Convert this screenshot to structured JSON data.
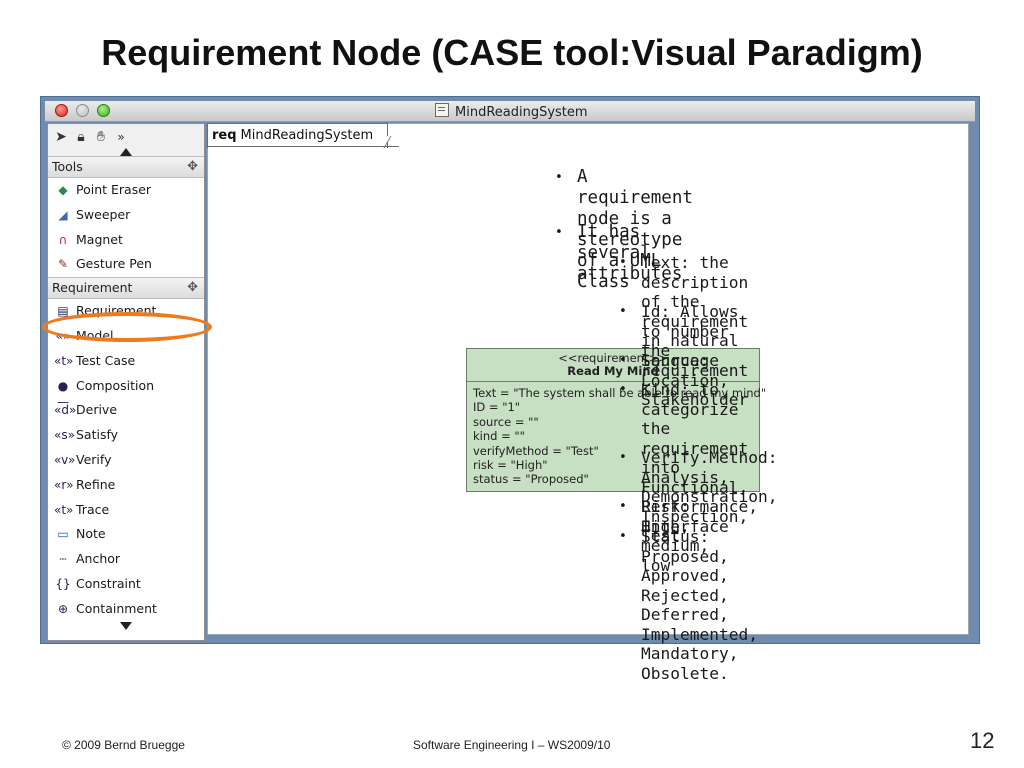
{
  "slide": {
    "title": "Requirement Node (CASE tool:Visual Paradigm)",
    "footer_left": "© 2009 Bernd Bruegge",
    "footer_center": "Software Engineering I – WS2009/10",
    "page_number": "12"
  },
  "window": {
    "title": "MindReadingSystem",
    "diagram_tab_keyword": "req",
    "diagram_tab_name": "MindReadingSystem"
  },
  "palette": {
    "toolbar_icons": [
      "pointer-icon",
      "lock-icon",
      "hand-icon",
      "expand-icon"
    ],
    "tools_header": "Tools",
    "requirement_header": "Requirement",
    "tools": [
      {
        "label": "Point Eraser",
        "icon": "eraser-icon"
      },
      {
        "label": "Sweeper",
        "icon": "sweeper-icon"
      },
      {
        "label": "Magnet",
        "icon": "magnet-icon"
      },
      {
        "label": "Gesture Pen",
        "icon": "pen-icon"
      }
    ],
    "requirement_items": [
      {
        "label": "Requirement",
        "icon_text": "▤"
      },
      {
        "label": "Model",
        "icon_text": "«»"
      },
      {
        "label": "Test Case",
        "icon_text": "«t»"
      },
      {
        "label": "Composition",
        "icon_text": "●—"
      },
      {
        "label": "Derive",
        "icon_text": "«d»"
      },
      {
        "label": "Satisfy",
        "icon_text": "«s»"
      },
      {
        "label": "Verify",
        "icon_text": "«v»"
      },
      {
        "label": "Refine",
        "icon_text": "«r»"
      },
      {
        "label": "Trace",
        "icon_text": "«t»"
      },
      {
        "label": "Note",
        "icon_text": "▭"
      },
      {
        "label": "Anchor",
        "icon_text": "┄"
      },
      {
        "label": "Constraint",
        "icon_text": "{}"
      },
      {
        "label": "Containment",
        "icon_text": "⊕"
      }
    ],
    "highlight_color": "#ee7a1e"
  },
  "requirement_node": {
    "stereotype": "<<requirement>>",
    "name": "Read My Mind",
    "fill_color": "#c7dfc2",
    "attributes": [
      "Text = \"The system shall be able to read my mind\"",
      "ID = \"1\"",
      "source = \"\"",
      "kind = \"\"",
      "verifyMethod = \"Test\"",
      "risk = \"High\"",
      "status = \"Proposed\""
    ]
  },
  "notes": {
    "level1": [
      "A requirement  node is a stereotype\nof a UML Class",
      "It has several attributes"
    ],
    "level2": [
      "Text: the description of the\nrequirement in natural language",
      "Id: Allows to number the\nrequirement",
      "Source: Location, Stakeholder",
      "Kind: to categorize the\nrequirement into Functional,\nPerformance, Interface",
      "Verify.Method: Analysis,\nDemonstration, Inspection, Test",
      "Risk: High, medium, low",
      "Status: Proposed, Approved,\nRejected, Deferred,\nImplemented, Mandatory,\nObsolete."
    ]
  }
}
